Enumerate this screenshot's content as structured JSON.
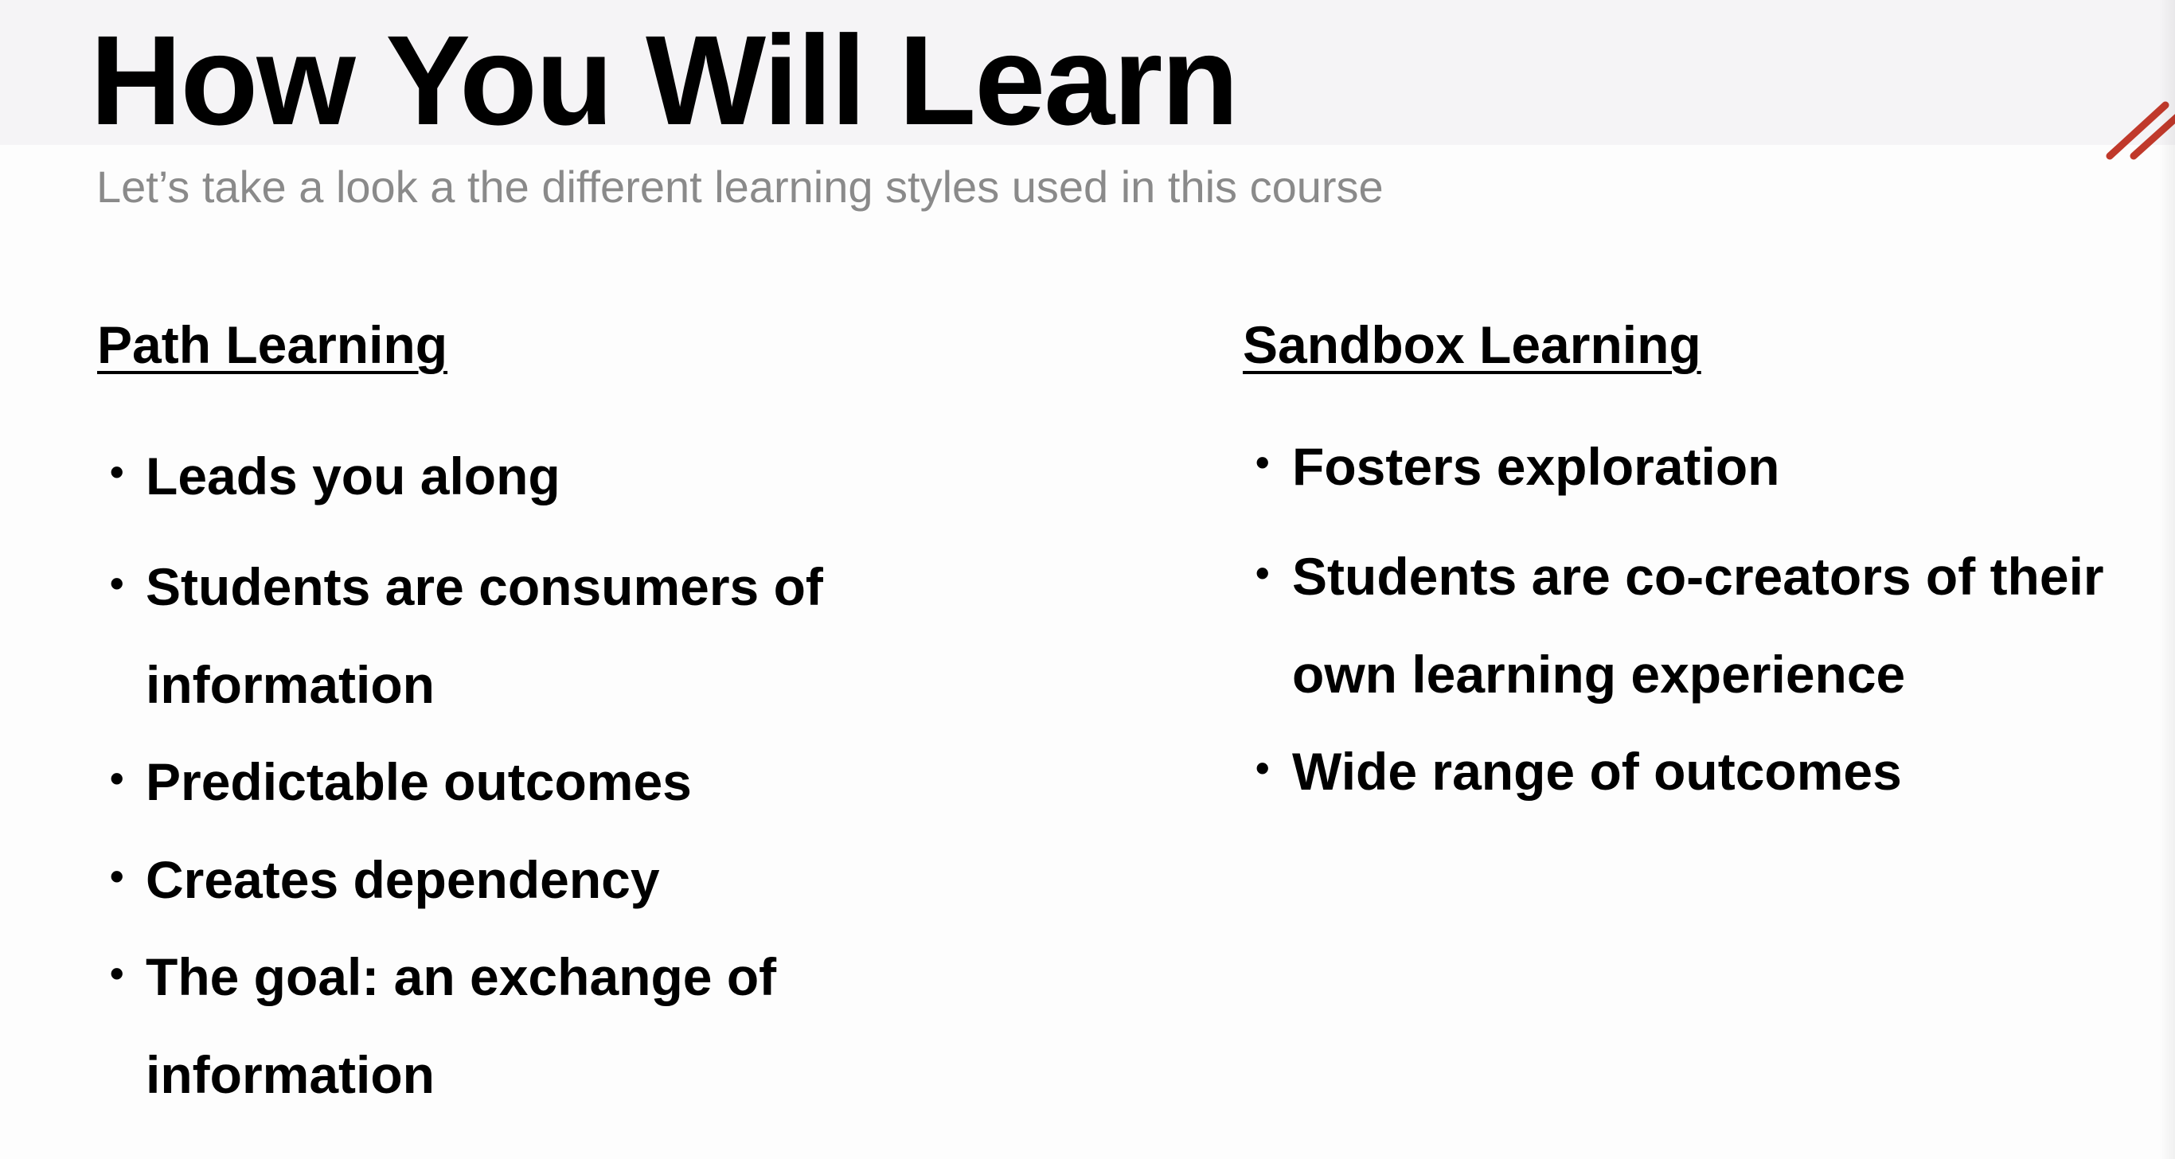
{
  "slide": {
    "title": "How You Will Learn",
    "subtitle": "Let’s take a look a the different learning styles used in this course",
    "accent_color": "#c0392b"
  },
  "columns": [
    {
      "heading": "Path Learning",
      "bullets": [
        {
          "lines": [
            "Leads you along"
          ]
        },
        {
          "lines": [
            "Students are consumers of",
            "information"
          ]
        },
        {
          "lines": [
            "Predictable outcomes"
          ]
        },
        {
          "lines": [
            "Creates dependency"
          ]
        },
        {
          "lines": [
            "The goal: an exchange of",
            "information"
          ]
        }
      ]
    },
    {
      "heading": "Sandbox Learning",
      "bullets": [
        {
          "lines": [
            "Fosters exploration"
          ]
        },
        {
          "lines": [
            "Students are co-creators of their",
            "own learning experience"
          ]
        },
        {
          "lines": [
            "Wide range of outcomes"
          ]
        }
      ]
    }
  ]
}
